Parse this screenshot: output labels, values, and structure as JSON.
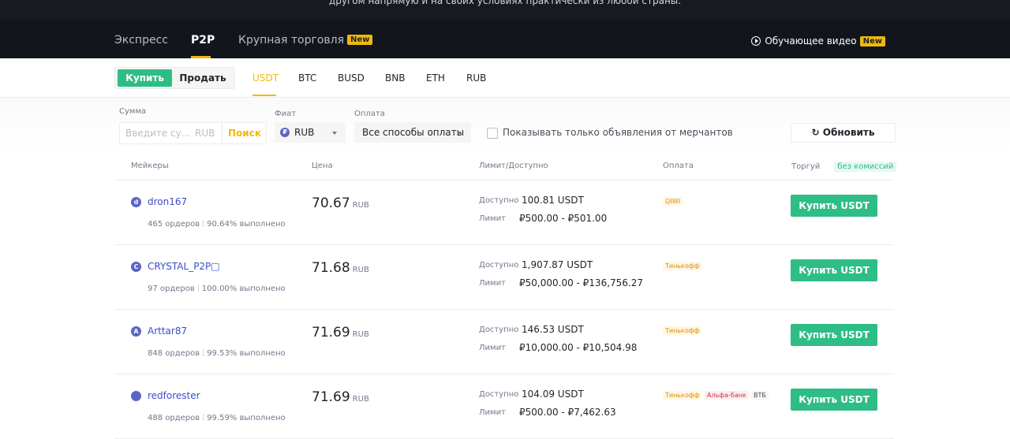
{
  "banner": {
    "text": "другом напрямую и на своих условиях практически из любой страны."
  },
  "topnav": {
    "items": [
      {
        "label": "Экспресс"
      },
      {
        "label": "P2P"
      },
      {
        "label": "Крупная торговля",
        "badge": "New"
      }
    ],
    "active": "P2P",
    "tutorial": {
      "label": "Обучающее видео",
      "badge": "New"
    }
  },
  "trade_toggle": {
    "buy": "Купить",
    "sell": "Продать",
    "active": "Купить"
  },
  "coins": [
    "USDT",
    "BTC",
    "BUSD",
    "BNB",
    "ETH",
    "RUB"
  ],
  "active_coin": "USDT",
  "filters": {
    "amount_label": "Сумма",
    "amount_placeholder": "Введите су...",
    "amount_currency": "RUB",
    "search_button": "Поиск",
    "fiat_label": "Фиат",
    "fiat_icon": "₽",
    "fiat_value": "RUB",
    "payment_label": "Оплата",
    "payment_value": "Все способы оплаты",
    "merchant_only_label": "Показывать только объявления от мерчантов",
    "refresh_button": "Обновить"
  },
  "table": {
    "headers": {
      "makers": "Мейкеры",
      "price": "Цена",
      "limit": "Лимит/Доступно",
      "payment": "Оплата",
      "trade": "Торгуй",
      "no_fee": "без комиссий"
    },
    "rows": [
      {
        "avatar": "d",
        "maker": "dron167",
        "orders": "465 ордеров",
        "completion": "90.64% выполнено",
        "price": "70.67",
        "currency": "RUB",
        "available_label": "Доступно",
        "available": "100.81 USDT",
        "limit_label": "Лимит",
        "limit": "₽500.00 - ₽501.00",
        "payments": [
          "QIWI"
        ],
        "action": "Купить USDT"
      },
      {
        "avatar": "C",
        "maker": "CRYSTAL_P2P□",
        "orders": "97 ордеров",
        "completion": "100.00% выполнено",
        "price": "71.68",
        "currency": "RUB",
        "available_label": "Доступно",
        "available": "1,907.87 USDT",
        "limit_label": "Лимит",
        "limit": "₽50,000.00 - ₽136,756.27",
        "payments": [
          "Тинькофф"
        ],
        "action": "Купить USDT"
      },
      {
        "avatar": "A",
        "maker": "Arttar87",
        "orders": "848 ордеров",
        "completion": "99.53% выполнено",
        "price": "71.69",
        "currency": "RUB",
        "available_label": "Доступно",
        "available": "146.53 USDT",
        "limit_label": "Лимит",
        "limit": "₽10,000.00 - ₽10,504.98",
        "payments": [
          "Тинькофф"
        ],
        "action": "Купить USDT"
      },
      {
        "avatar": "",
        "maker": "redforester",
        "orders": "488 ордеров",
        "completion": "99.59% выполнено",
        "price": "71.69",
        "currency": "RUB",
        "available_label": "Доступно",
        "available": "104.09 USDT",
        "limit_label": "Лимит",
        "limit": "₽500.00 - ₽7,462.63",
        "payments": [
          "Тинькофф",
          "Альфа-банк",
          "ВТБ"
        ],
        "action": "Купить USDT"
      }
    ]
  },
  "colors": {
    "accent": "#f0b90b",
    "buy_green": "#2ebd85",
    "nav_bg": "#12161c",
    "maker_link": "#3c4cc9"
  }
}
